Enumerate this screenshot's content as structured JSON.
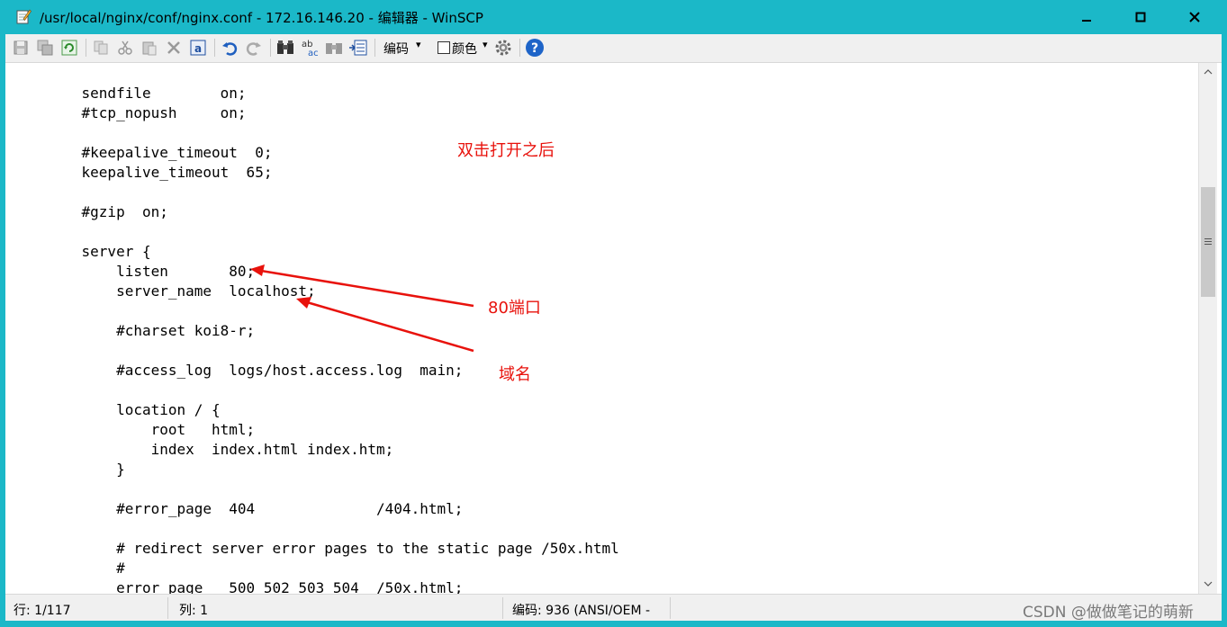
{
  "window": {
    "title": "/usr/local/nginx/conf/nginx.conf - 172.16.146.20 - 编辑器 - WinSCP",
    "title_bar_color": "#1bb8c8"
  },
  "toolbar": {
    "encoding_label": "编码",
    "color_label": "颜色",
    "icons": [
      "save-icon",
      "save-all-icon",
      "reload-icon",
      "copy-icon",
      "cut-icon",
      "paste-icon",
      "delete-icon",
      "select-all-icon",
      "undo-icon",
      "redo-icon",
      "find-icon",
      "replace-icon",
      "find-next-icon",
      "goto-line-icon",
      "settings-icon",
      "help-icon"
    ]
  },
  "editor": {
    "lines": [
      "    sendfile        on;",
      "    #tcp_nopush     on;",
      "",
      "    #keepalive_timeout  0;",
      "    keepalive_timeout  65;",
      "",
      "    #gzip  on;",
      "",
      "    server {",
      "        listen       80;",
      "        server_name  localhost;",
      "",
      "        #charset koi8-r;",
      "",
      "        #access_log  logs/host.access.log  main;",
      "",
      "        location / {",
      "            root   html;",
      "            index  index.html index.htm;",
      "        }",
      "",
      "        #error_page  404              /404.html;",
      "",
      "        # redirect server error pages to the static page /50x.html",
      "        #",
      "        error_page   500 502 503 504  /50x.html;"
    ]
  },
  "annotations": {
    "note_open": "双击打开之后",
    "note_port": "80端口",
    "note_domain": "域名",
    "color": "#e8120c"
  },
  "statusbar": {
    "line": "行: 1/117",
    "column": "列: 1",
    "encoding": "编码: 936  (ANSI/OEM -",
    "watermark": "CSDN @做做笔记的萌新"
  }
}
